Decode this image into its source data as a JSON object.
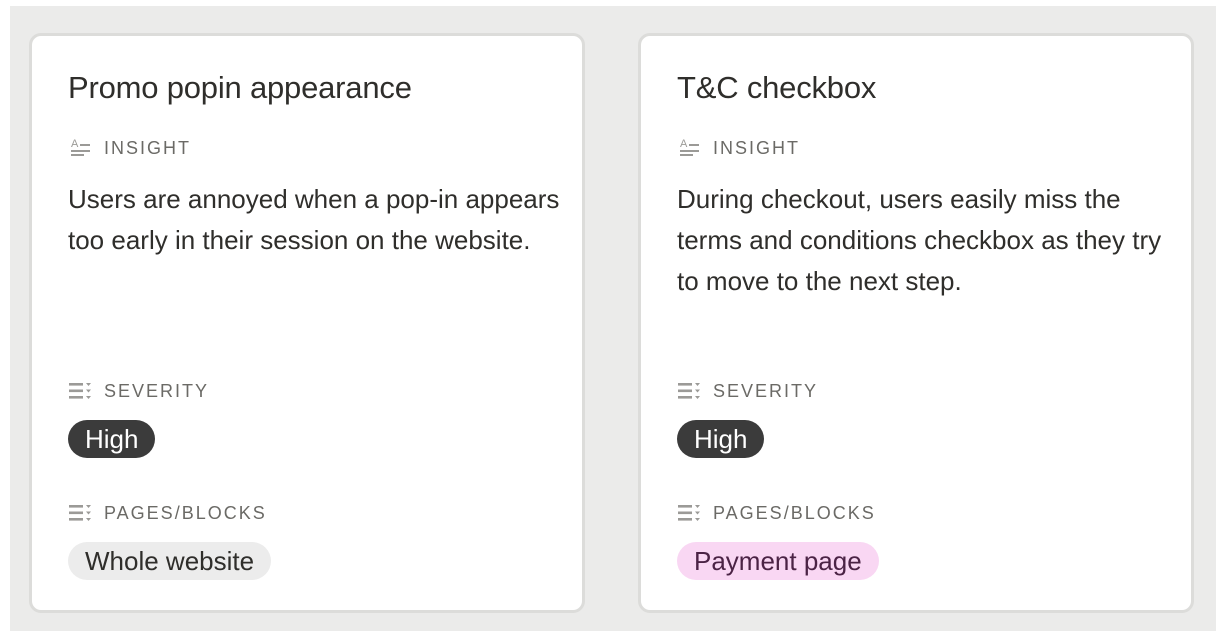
{
  "cards": [
    {
      "title": "Promo popin appearance",
      "insight_label": "INSIGHT",
      "insight_icon": "text-property-icon",
      "insight_text": "Users are annoyed when a pop-in appears too early in their session on the website.",
      "severity_label": "SEVERITY",
      "severity_icon": "multi-select-icon",
      "severity_value": "High",
      "pages_label": "PAGES/BLOCKS",
      "pages_icon": "multi-select-icon",
      "pages_value": "Whole website",
      "pages_color": "#ececec"
    },
    {
      "title": "T&C checkbox",
      "insight_label": "INSIGHT",
      "insight_icon": "text-property-icon",
      "insight_text": "During checkout, users easily miss the terms and conditions checkbox as they try to move to the next step.",
      "severity_label": "SEVERITY",
      "severity_icon": "multi-select-icon",
      "severity_value": "High",
      "pages_label": "PAGES/BLOCKS",
      "pages_icon": "multi-select-icon",
      "pages_value": "Payment page",
      "pages_color": "#f9d7f3"
    }
  ],
  "colors": {
    "board_background": "#ebebea",
    "severity_high": "#3b3b3b"
  }
}
